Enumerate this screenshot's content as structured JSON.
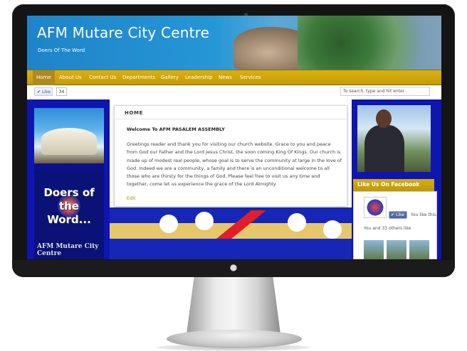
{
  "site": {
    "title": "AFM Mutare City Centre",
    "tagline": "Doers Of The Word"
  },
  "nav": {
    "items": [
      {
        "label": "Home",
        "active": true
      },
      {
        "label": "About Us",
        "active": false
      },
      {
        "label": "Contact Us",
        "active": false
      },
      {
        "label": "Departments",
        "active": false
      },
      {
        "label": "Gallery",
        "active": false
      },
      {
        "label": "Leadership",
        "active": false
      },
      {
        "label": "News",
        "active": false
      },
      {
        "label": "Services",
        "active": false
      }
    ]
  },
  "toolbar": {
    "like_label": "Like",
    "like_count": "34",
    "search_placeholder": "To search, type and hit enter"
  },
  "left": {
    "doers_text": "Doers of the Word...",
    "city_text": "AFM Mutare City Centre"
  },
  "content": {
    "section": "HOME",
    "heading": "Welcome To AFM PASALEM ASSEMBLY",
    "body": "Greetings reader and thank you for visiting our church website. Grace to you and peace from God our Father and the Lord Jesus Christ, the soon coming King Of Kings. Our church is made up of modest real people, whose goal is to serve the community at large in the love of God. Indeed we are a community, a family and there is an unconditional welcome to all those who are thirsty for the things of God. Please feel free to visit us any time and together, come let us experience the grace of the Lord Almighty",
    "edit_label": "Edit"
  },
  "facebook": {
    "title": "Like Us On Facebook",
    "like_label": "Like",
    "you_like": "You like this.",
    "others": "You and 33 others like"
  },
  "device": {
    "logo_icon": "apple-logo-icon"
  },
  "colors": {
    "nav_gold": "#c69c06",
    "page_blue": "#0e15b0",
    "header_blue": "#1e84c9"
  }
}
